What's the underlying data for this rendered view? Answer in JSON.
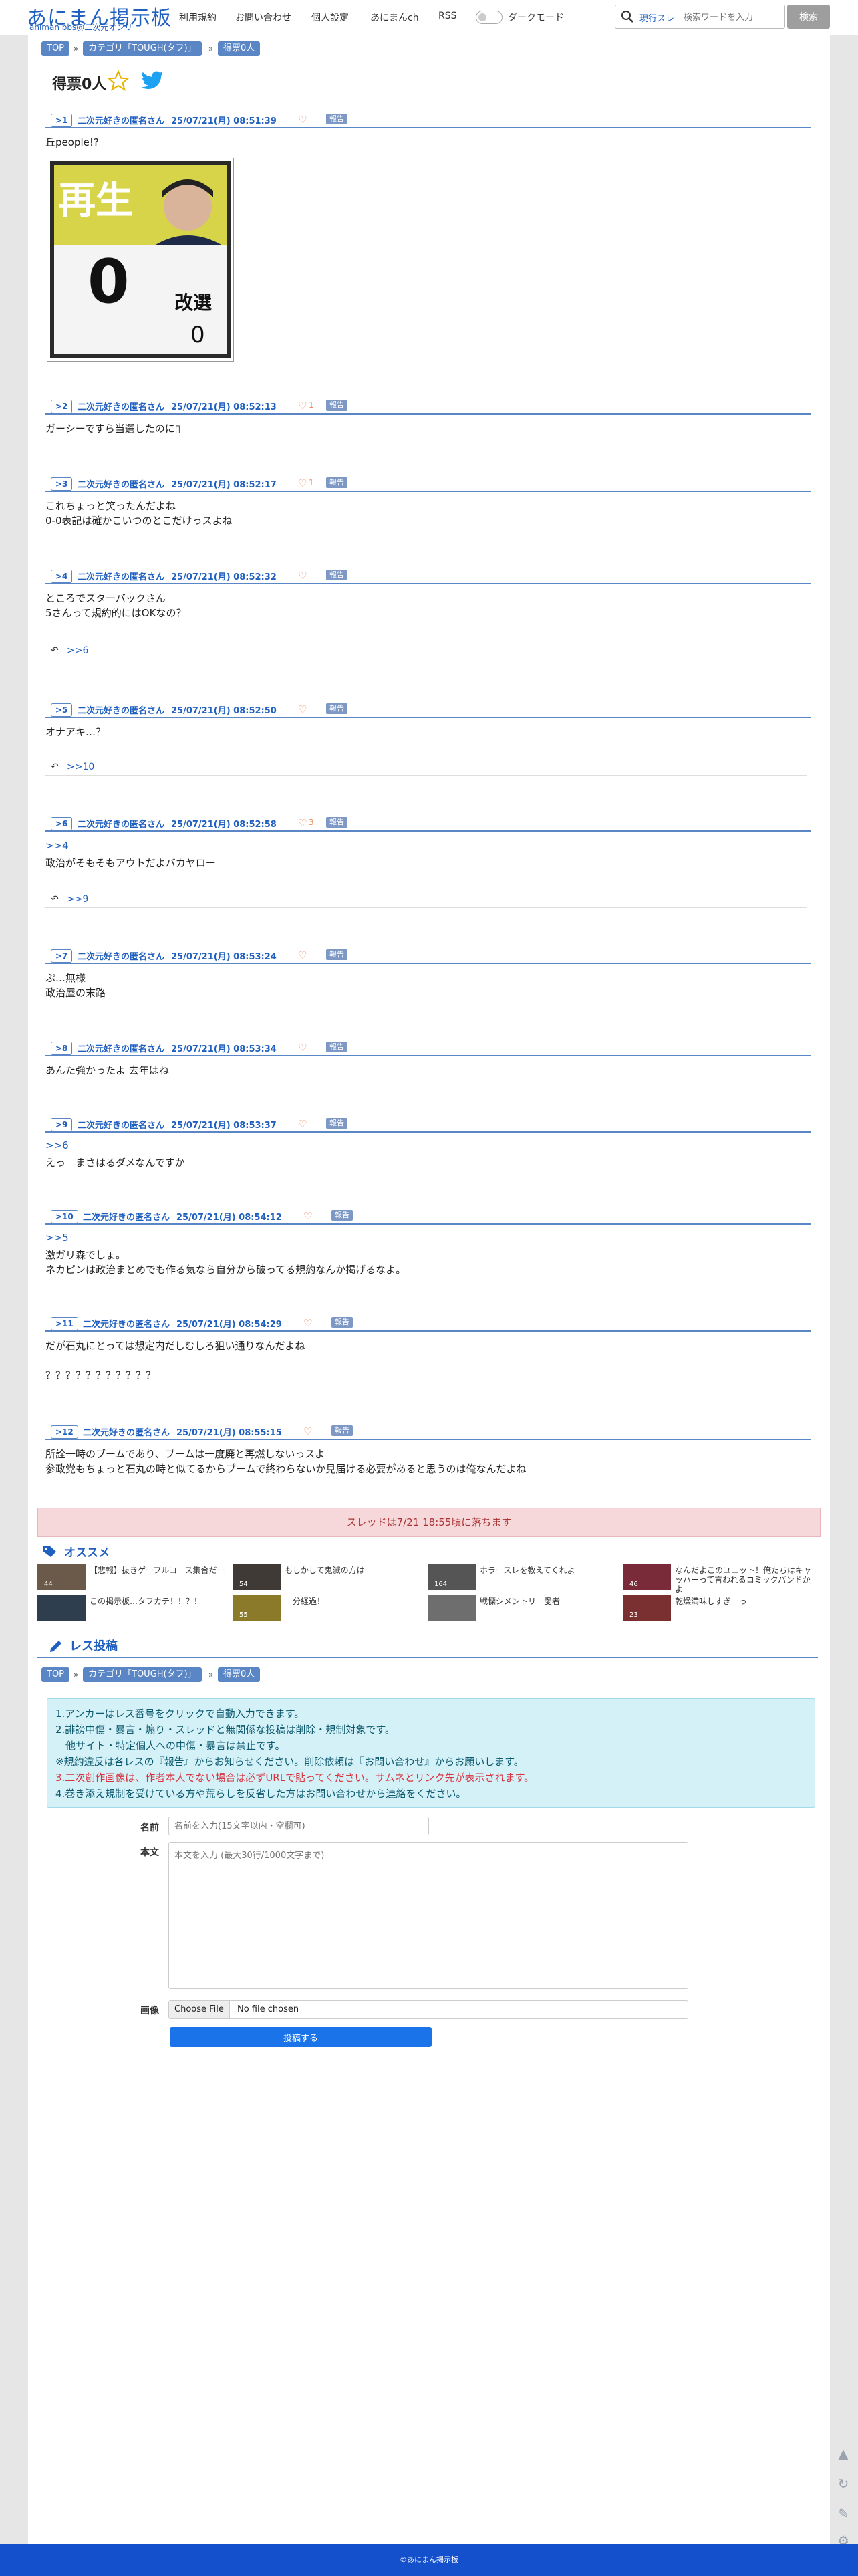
{
  "header": {
    "logo_main": "あにまん掲示板",
    "logo_sub": "animan bbs@二次元オンリー",
    "nav": [
      "利用規約",
      "お問い合わせ",
      "個人設定",
      "あにまんch",
      "RSS"
    ],
    "dark_mode_label": "ダークモード",
    "search_scope": "現行スレ",
    "search_placeholder": "検索ワードを入力",
    "search_button": "検索"
  },
  "breadcrumb": {
    "top": "TOP",
    "category": "カテゴリ「TOUGH(タフ)」",
    "current": "得票0人"
  },
  "thread": {
    "title": "得票0人"
  },
  "image": {
    "top_text": "再生",
    "count": "0",
    "label": "改選",
    "small_count": "0"
  },
  "posts": [
    {
      "num": ">1",
      "name": "二次元好きの匿名さん",
      "date": "25/07/21(月) 08:51:39",
      "likes": "",
      "anchor": "",
      "body": "丘people!?",
      "reply": ""
    },
    {
      "num": ">2",
      "name": "二次元好きの匿名さん",
      "date": "25/07/21(月) 08:52:13",
      "likes": "1",
      "anchor": "",
      "body": "ガーシーですら当選したのに▯",
      "reply": ""
    },
    {
      "num": ">3",
      "name": "二次元好きの匿名さん",
      "date": "25/07/21(月) 08:52:17",
      "likes": "1",
      "anchor": "",
      "body": "これちょっと笑ったんだよね\n0-0表記は確かこいつのとこだけっスよね",
      "reply": ""
    },
    {
      "num": ">4",
      "name": "二次元好きの匿名さん",
      "date": "25/07/21(月) 08:52:32",
      "likes": "",
      "anchor": "",
      "body": "ところでスターバックさん\n5さんって規約的にはOKなの？",
      "reply": ">>6"
    },
    {
      "num": ">5",
      "name": "二次元好きの匿名さん",
      "date": "25/07/21(月) 08:52:50",
      "likes": "",
      "anchor": "",
      "body": "オナアキ…？",
      "reply": ">>10"
    },
    {
      "num": ">6",
      "name": "二次元好きの匿名さん",
      "date": "25/07/21(月) 08:52:58",
      "likes": "3",
      "anchor": ">>4",
      "body": "政治がそもそもアウトだよバカヤロー",
      "reply": ">>9"
    },
    {
      "num": ">7",
      "name": "二次元好きの匿名さん",
      "date": "25/07/21(月) 08:53:24",
      "likes": "",
      "anchor": "",
      "body": "ぷ…無様\n政治屋の末路",
      "reply": ""
    },
    {
      "num": ">8",
      "name": "二次元好きの匿名さん",
      "date": "25/07/21(月) 08:53:34",
      "likes": "",
      "anchor": "",
      "body": "あんた強かったよ 去年はね",
      "reply": ""
    },
    {
      "num": ">9",
      "name": "二次元好きの匿名さん",
      "date": "25/07/21(月) 08:53:37",
      "likes": "",
      "anchor": ">>6",
      "body": "えっ　まさはるダメなんですか",
      "reply": ""
    },
    {
      "num": ">10",
      "name": "二次元好きの匿名さん",
      "date": "25/07/21(月) 08:54:12",
      "likes": "",
      "anchor": ">>5",
      "body": "激ガリ森でしょ。\nネカピンは政治まとめでも作る気なら自分から破ってる規約なんか掲げるなよ。",
      "reply": ""
    },
    {
      "num": ">11",
      "name": "二次元好きの匿名さん",
      "date": "25/07/21(月) 08:54:29",
      "likes": "",
      "anchor": "",
      "body": "だが石丸にとっては想定内だしむしろ狙い通りなんだよね\n\n？？？？？？？？？？？",
      "reply": ""
    },
    {
      "num": ">12",
      "name": "二次元好きの匿名さん",
      "date": "25/07/21(月) 08:55:15",
      "likes": "",
      "anchor": "",
      "body": "所詮一時のブームであり、ブームは一度廃と再燃しないっスよ\n参政党もちょっと石丸の時と似てるからブームで終わらないか見届ける必要があると思うのは俺なんだよね",
      "reply": ""
    }
  ],
  "notice": "スレッドは7/21 18:55頃に落ちます",
  "osusume": {
    "title": "オススメ",
    "items": [
      {
        "title": "【悲報】抜きゲーフルコース集合だー",
        "count": "44",
        "color": "#6b5a4a"
      },
      {
        "title": "もしかして鬼滅の方は",
        "count": "54",
        "color": "#3f3a36"
      },
      {
        "title": "ホラースレを教えてくれよ",
        "count": "164",
        "color": "#555555"
      },
      {
        "title": "なんだよこのユニット！俺たちはキャッハーって言われるコミックバンドかよ",
        "count": "46",
        "color": "#7a2b3a"
      },
      {
        "title": "この掲示板…タフカテ！！？！",
        "count": "",
        "color": "#2f3e4f"
      },
      {
        "title": "一分経過！",
        "count": "55",
        "color": "#8a7a2a"
      },
      {
        "title": "戦慄シメントリー愛者",
        "count": "",
        "color": "#6e6e6e"
      },
      {
        "title": "乾燥満味しすぎーっ",
        "count": "23",
        "color": "#7a3030"
      }
    ]
  },
  "res_form": {
    "title": "レス投稿",
    "rules": [
      "1.アンカーはレス番号をクリックで自動入力できます。",
      "2.誹謗中傷・暴言・煽り・スレッドと無関係な投稿は削除・規制対象です。",
      "　他サイト・特定個人への中傷・暴言は禁止です。",
      "※規約違反は各レスの『報告』からお知らせください。削除依頼は『お問い合わせ』からお願いします。",
      "3.二次創作画像は、作者本人でない場合は必ずURLで貼ってください。サムネとリンク先が表示されます。",
      "4.巻き添え規制を受けている方や荒らしを反省した方はお問い合わせから連絡をください。"
    ],
    "name_label": "名前",
    "name_placeholder": "名前を入力(15文字以内・空欄可)",
    "body_label": "本文",
    "body_placeholder": "本文を入力 (最大30行/1000文字まで)",
    "image_label": "画像",
    "file_button": "Choose File",
    "file_text": "No file chosen",
    "submit": "投稿する"
  },
  "footer": "©あにまん掲示板",
  "colors": {
    "accent": "#1f5fbf",
    "report": "#7d98c5",
    "heart": "#e8895b",
    "footer": "#1450cc"
  }
}
